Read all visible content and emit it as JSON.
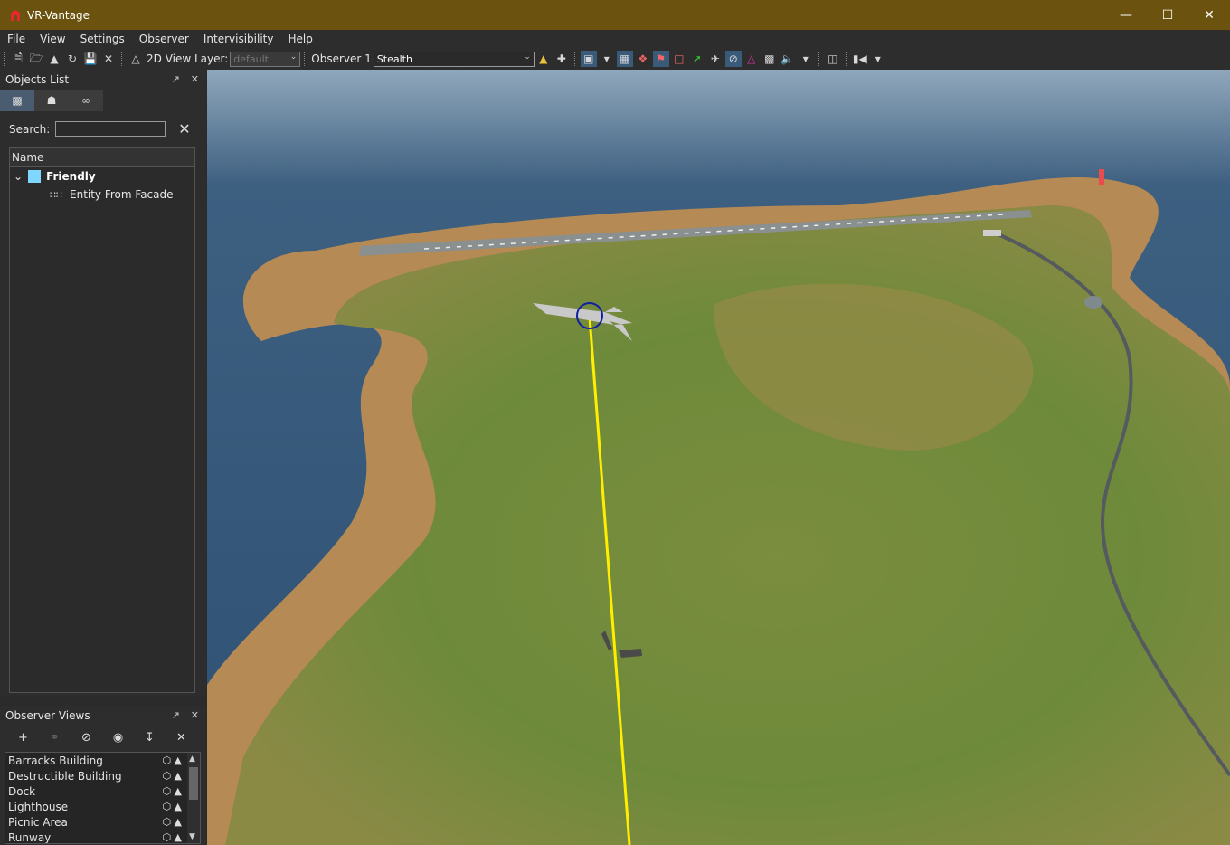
{
  "window": {
    "title": "VR-Vantage"
  },
  "menu": [
    "File",
    "View",
    "Settings",
    "Observer",
    "Intervisibility",
    "Help"
  ],
  "toolbar": {
    "view_layer_label": "2D View Layer:",
    "view_layer_value": "default",
    "observer_label": "Observer 1",
    "observer_value": "Stealth"
  },
  "objects_panel": {
    "title": "Objects List",
    "search_label": "Search:",
    "column_name": "Name",
    "group": "Friendly",
    "entity": "Entity From Facade",
    "group_color": "#7fd6ff"
  },
  "observer_views": {
    "title": "Observer Views",
    "items": [
      "Barracks Building",
      "Destructible Building",
      "Dock",
      "Lighthouse",
      "Picnic Area",
      "Runway"
    ]
  },
  "colors": {
    "titlebar": "#6b520e",
    "line_of_sight": "#ffee00"
  }
}
